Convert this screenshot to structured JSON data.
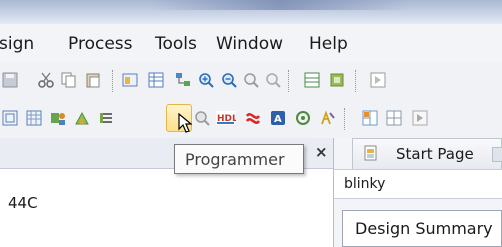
{
  "menu": {
    "items": [
      "sign",
      "Process",
      "Tools",
      "Window",
      "Help"
    ]
  },
  "toolbar1": {
    "icons": [
      "save-icon",
      "cut-icon",
      "copy-icon",
      "paste-icon",
      "project-icon",
      "table-icon",
      "hierarchy-icon",
      "zoom-in-icon",
      "zoom-out-icon",
      "zoom-fit-icon",
      "zoom-icon",
      "grid-icon",
      "chip-icon",
      "panel-icon"
    ]
  },
  "toolbar2": {
    "icons": [
      "rtl-icon",
      "netlist-icon",
      "assignment-icon",
      "pin-icon",
      "timing-icon",
      "programmer-icon",
      "chip-planner-icon",
      "hdl-icon",
      "signaltap-icon",
      "ip-icon",
      "settings-icon",
      "analyzer-icon",
      "split-icon",
      "layout-icon",
      "play-icon"
    ]
  },
  "tooltip": {
    "label": "Programmer"
  },
  "left_panel": {
    "close_label": "×",
    "item": "44C"
  },
  "right_panel": {
    "tab_label": "Start Page",
    "project": "blinky",
    "summary": "Design Summary"
  },
  "colors": {
    "title_bar": "#c9d3e6",
    "menu_bg": "#f3f4f7",
    "highlight": "#ffe08a"
  }
}
